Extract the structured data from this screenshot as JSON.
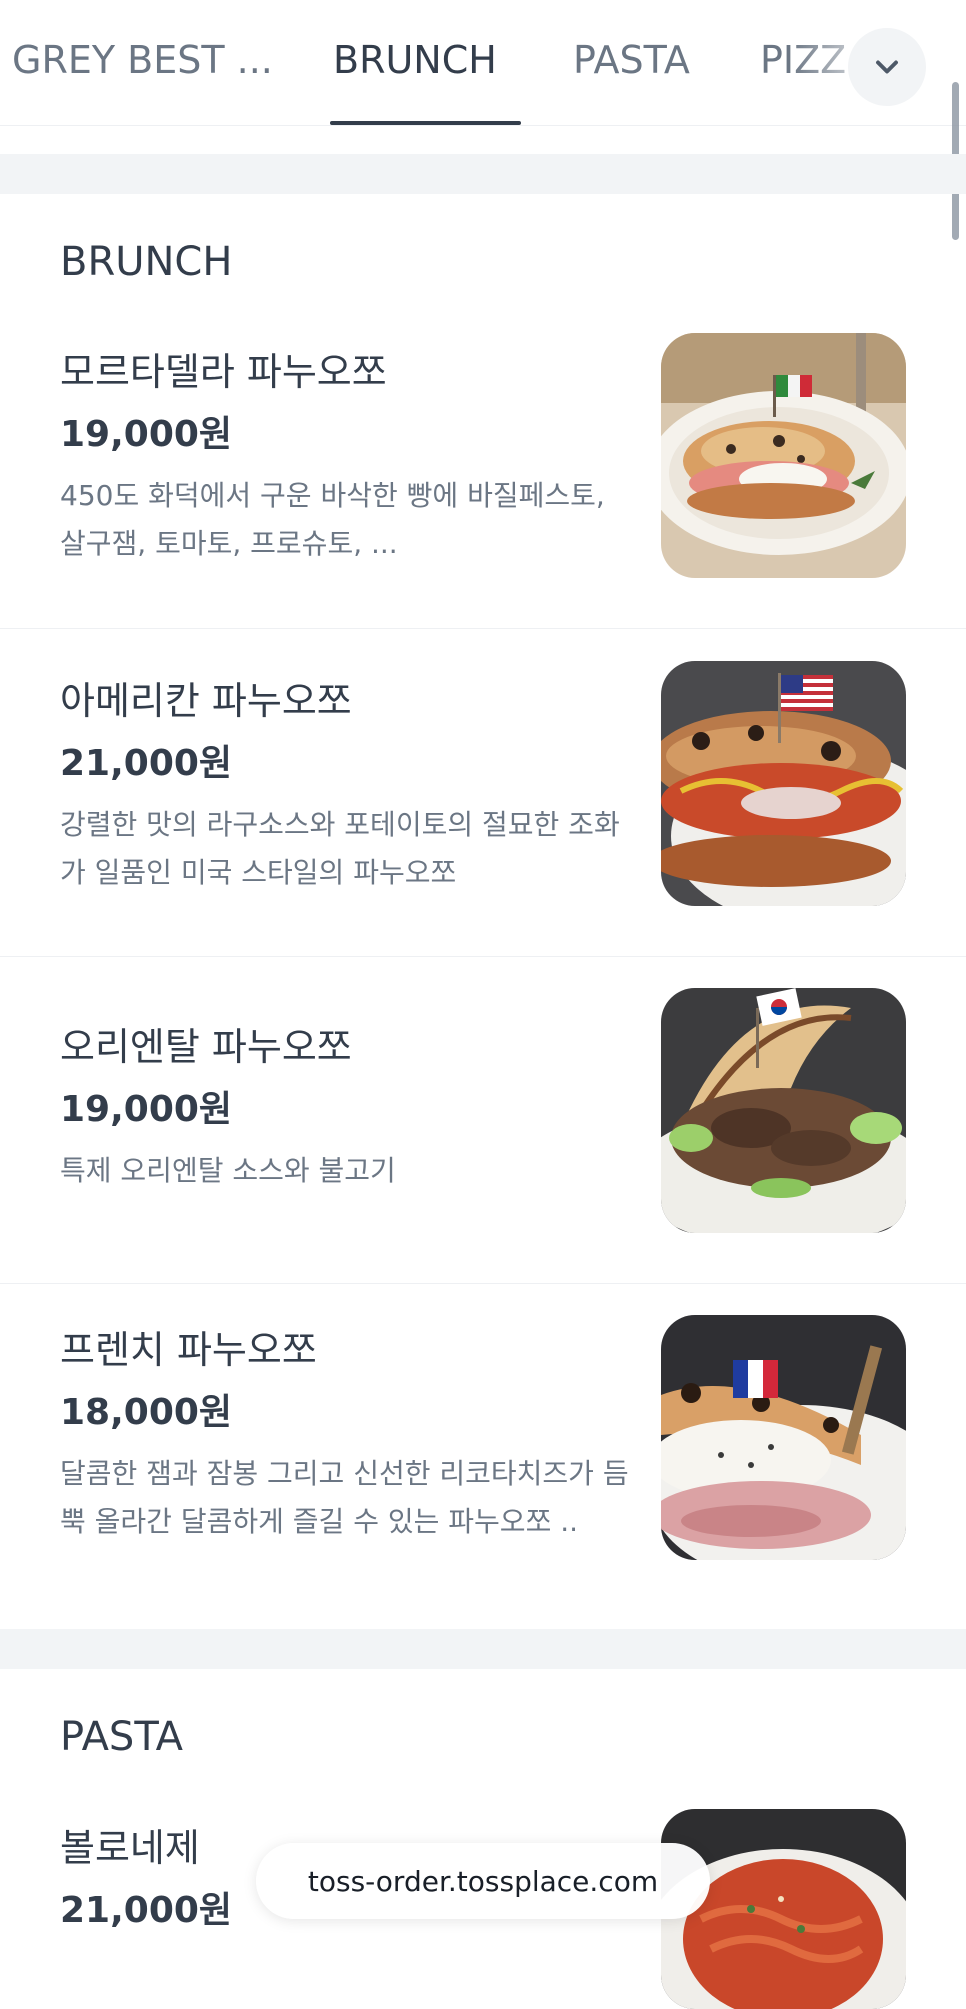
{
  "tabs": [
    {
      "label": "GREY BEST ..."
    },
    {
      "label": "BRUNCH"
    },
    {
      "label": "PASTA"
    },
    {
      "label": "PIZZ"
    }
  ],
  "active_tab": "BRUNCH",
  "sections": [
    {
      "title": "BRUNCH",
      "items": [
        {
          "name": "모르타델라 파누오쪼",
          "price": "19,000원",
          "description": "450도 화덕에서 구운 바삭한 빵에 바질페스토, 살구잼, 토마토, 프로슈토, ...",
          "flag": "italy"
        },
        {
          "name": "아메리칸 파누오쪼",
          "price": "21,000원",
          "description": "강렬한 맛의 라구소스와 포테이토의 절묘한 조화가 일품인 미국  스타일의 파누오쪼",
          "flag": "usa"
        },
        {
          "name": "오리엔탈 파누오쪼",
          "price": "19,000원",
          "description": "특제 오리엔탈 소스와 불고기",
          "flag": "korea"
        },
        {
          "name": "프렌치 파누오쪼",
          "price": "18,000원",
          "description": "달콤한 잼과 잠봉 그리고 신선한 리코타치즈가 듬뿍 올라간 달콤하게 즐길 수 있는 파누오쪼  ..",
          "flag": "france"
        }
      ]
    },
    {
      "title": "PASTA",
      "items": [
        {
          "name": "볼로네제",
          "price": "21,000원",
          "description": ""
        }
      ]
    }
  ],
  "url_bar": {
    "text": "toss-order.tossplace.com"
  },
  "icons": {
    "dropdown": "chevron-down-icon"
  },
  "colors": {
    "text": "#333d4b",
    "subtext": "#6b7684",
    "section_gap": "#f2f4f6"
  }
}
